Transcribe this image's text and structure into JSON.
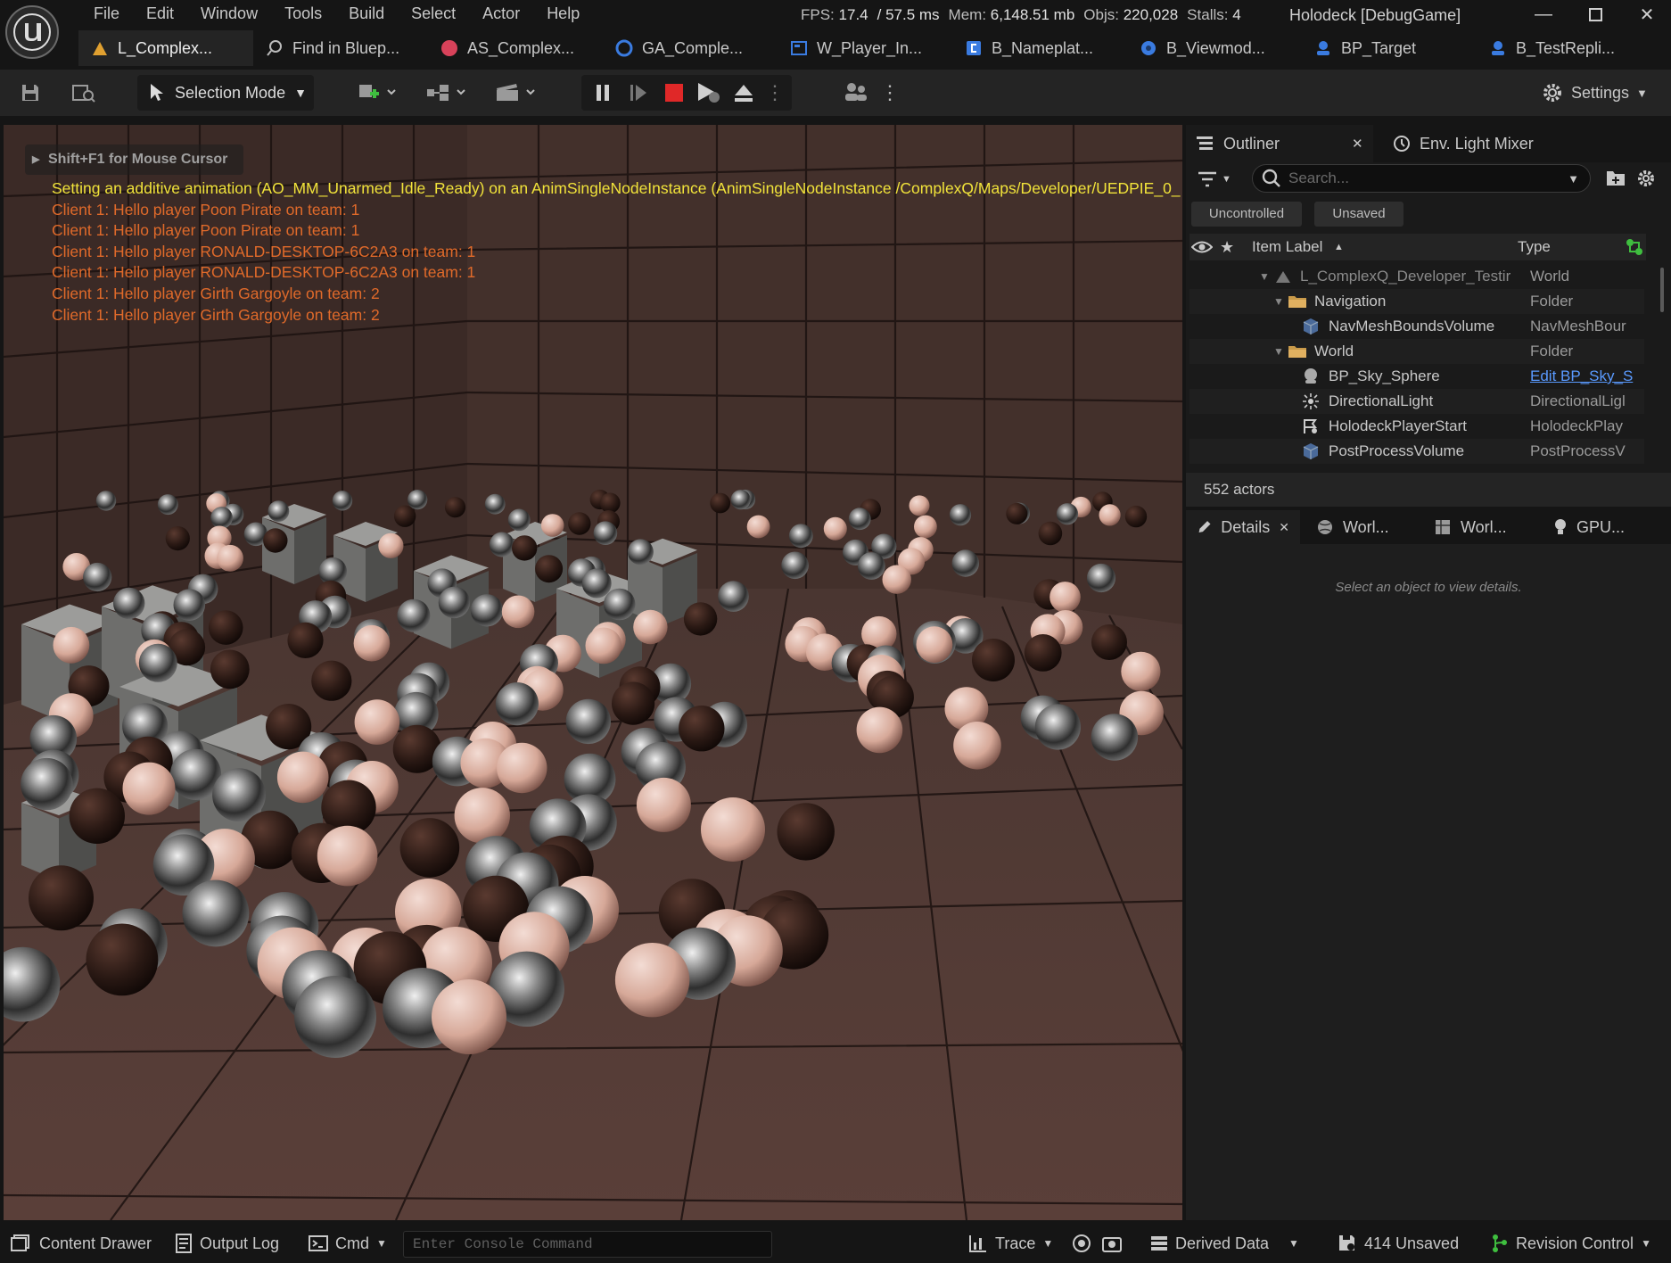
{
  "menu": [
    "File",
    "Edit",
    "Window",
    "Tools",
    "Build",
    "Select",
    "Actor",
    "Help"
  ],
  "stats": {
    "fps_label": "FPS:",
    "fps": "17.4",
    "ms": "/ 57.5 ms",
    "mem_label": "Mem:",
    "mem": "6,148.51 mb",
    "objs_label": "Objs:",
    "objs": "220,028",
    "stalls_label": "Stalls:",
    "stalls": "4"
  },
  "project_name": "Holodeck [DebugGame]",
  "tabs": [
    {
      "label": "L_Complex...",
      "icon": "level-icon",
      "color": "#e0a030"
    },
    {
      "label": "Find in Bluep...",
      "icon": "find-icon",
      "color": "#bbbbbb"
    },
    {
      "label": "AS_Complex...",
      "icon": "anim-sequence-icon",
      "color": "#d8425a"
    },
    {
      "label": "GA_Comple...",
      "icon": "gameplay-ability-icon",
      "color": "#3a7be0"
    },
    {
      "label": "W_Player_In...",
      "icon": "widget-icon",
      "color": "#3a7be0"
    },
    {
      "label": "B_Nameplat...",
      "icon": "blueprint-icon",
      "color": "#3a7be0"
    },
    {
      "label": "B_Viewmod...",
      "icon": "blueprint-class-icon",
      "color": "#3a7be0"
    },
    {
      "label": "BP_Target",
      "icon": "actor-blueprint-icon",
      "color": "#3a7be0"
    },
    {
      "label": "B_TestRepli...",
      "icon": "actor-blueprint-icon",
      "color": "#3a7be0"
    }
  ],
  "toolbar": {
    "selection_mode": "Selection Mode",
    "settings": "Settings"
  },
  "viewport": {
    "hint": "Shift+F1 for Mouse Cursor",
    "warning": "Setting an additive animation (AO_MM_Unarmed_Idle_Ready) on an AnimSingleNodeInstance (AnimSingleNodeInstance /ComplexQ/Maps/Developer/UEDPIE_0_",
    "log": [
      "Client 1: Hello player Poon Pirate on team: 1",
      "Client 1: Hello player Poon Pirate on team: 1",
      "Client 1: Hello player RONALD-DESKTOP-6C2A3 on team: 1",
      "Client 1: Hello player RONALD-DESKTOP-6C2A3 on team: 1",
      "Client 1: Hello player Girth Gargoyle on team: 2",
      "Client 1: Hello player Girth Gargoyle on team: 2"
    ]
  },
  "outliner": {
    "tab": "Outliner",
    "tab2": "Env. Light Mixer",
    "search_placeholder": "Search...",
    "chips": [
      "Uncontrolled",
      "Unsaved"
    ],
    "col_label": "Item Label",
    "col_type": "Type",
    "rows": [
      {
        "label": "L_ComplexQ_Developer_Testir",
        "type": "World",
        "icon": "world-icon"
      },
      {
        "label": "Navigation",
        "type": "Folder",
        "icon": "folder-icon"
      },
      {
        "label": "NavMeshBoundsVolume",
        "type": "NavMeshBour",
        "icon": "volume-icon"
      },
      {
        "label": "World",
        "type": "Folder",
        "icon": "folder-icon"
      },
      {
        "label": "BP_Sky_Sphere",
        "type": "Edit BP_Sky_S",
        "icon": "sky-sphere-icon",
        "type_link": true
      },
      {
        "label": "DirectionalLight",
        "type": "DirectionalLigl",
        "icon": "directional-light-icon"
      },
      {
        "label": "HolodeckPlayerStart",
        "type": "HolodeckPlay",
        "icon": "player-start-icon"
      },
      {
        "label": "PostProcessVolume",
        "type": "PostProcessV",
        "icon": "volume-icon"
      }
    ],
    "actors": "552 actors"
  },
  "details": {
    "tabs": [
      "Details",
      "Worl...",
      "Worl...",
      "GPU..."
    ],
    "empty": "Select an object to view details."
  },
  "statusbar": {
    "content_drawer": "Content Drawer",
    "output_log": "Output Log",
    "cmd": "Cmd",
    "console_placeholder": "Enter Console Command",
    "trace": "Trace",
    "derived_data": "Derived Data",
    "unsaved": "414 Unsaved",
    "revision_control": "Revision Control"
  },
  "colors": {
    "accent": "#3a7be0",
    "warning": "#f1e33a",
    "log": "#e06a2a",
    "stop": "#e02828"
  }
}
